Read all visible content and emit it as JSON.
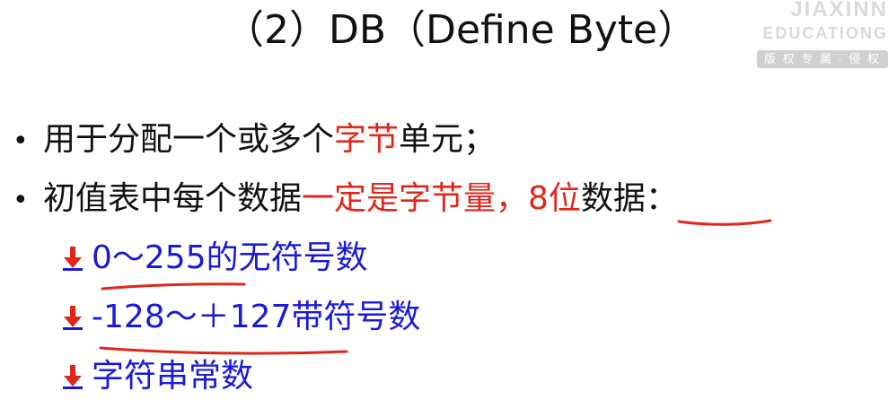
{
  "slide": {
    "title": "（2）DB（Define Byte）"
  },
  "watermark": {
    "line1": "JIAXINN",
    "line2": "EDUCATIONG",
    "badge": "版 权 专 属 · 侵 权"
  },
  "bullets": [
    {
      "parts": [
        {
          "text": "用于分配一个或多个",
          "color": "black"
        },
        {
          "text": "字节",
          "color": "red"
        },
        {
          "text": "单元；",
          "color": "black"
        }
      ]
    },
    {
      "parts": [
        {
          "text": "初值表中每个数据",
          "color": "black"
        },
        {
          "text": "一定是字节量，",
          "color": "red"
        },
        {
          "text": "8位",
          "color": "red"
        },
        {
          "text": "数据：",
          "color": "black"
        }
      ]
    }
  ],
  "sub_items": [
    {
      "text": "0～255的无符号数"
    },
    {
      "text": "-128～＋127带符号数"
    },
    {
      "text": "字符串常数"
    }
  ],
  "colors": {
    "text": "#111111",
    "highlight_red": "#e0261b",
    "sub_blue": "#1a1ad6",
    "ink_underline": "#e0261b",
    "arrow_icon": "#e0261b"
  }
}
